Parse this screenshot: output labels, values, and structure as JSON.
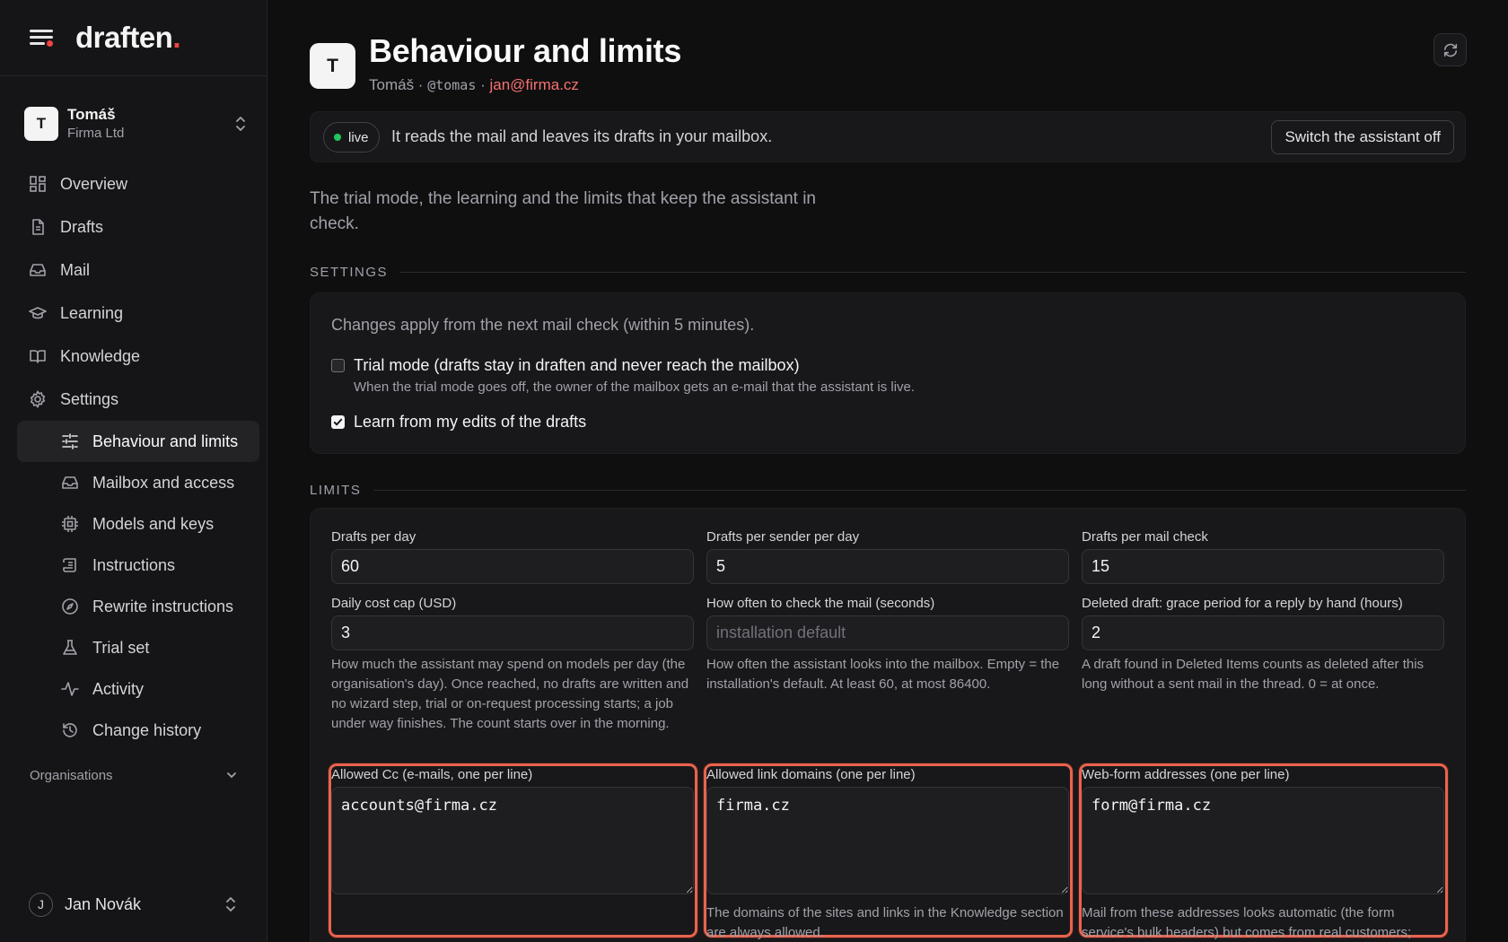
{
  "brand": {
    "name": "draften",
    "dot": "."
  },
  "account": {
    "initial": "T",
    "name": "Tomáš",
    "org": "Firma Ltd"
  },
  "nav": {
    "items": [
      {
        "label": "Overview"
      },
      {
        "label": "Drafts"
      },
      {
        "label": "Mail"
      },
      {
        "label": "Learning"
      },
      {
        "label": "Knowledge"
      },
      {
        "label": "Settings"
      }
    ],
    "settings_sub": [
      {
        "label": "Behaviour and limits"
      },
      {
        "label": "Mailbox and access"
      },
      {
        "label": "Models and keys"
      },
      {
        "label": "Instructions"
      },
      {
        "label": "Rewrite instructions"
      },
      {
        "label": "Trial set"
      },
      {
        "label": "Activity"
      },
      {
        "label": "Change history"
      }
    ],
    "organisations_label": "Organisations"
  },
  "user": {
    "initial": "J",
    "name": "Jan Novák"
  },
  "header": {
    "avatar_initial": "T",
    "title": "Behaviour and limits",
    "name": "Tomáš",
    "sep1": " · ",
    "handle": "@tomas",
    "sep2": " · ",
    "email": "jan@firma.cz"
  },
  "status": {
    "badge": "live",
    "text": "It reads the mail and leaves its drafts in your mailbox.",
    "button": "Switch the assistant off"
  },
  "intro": "The trial mode, the learning and the limits that keep the assistant in check.",
  "settings": {
    "section_label": "SETTINGS",
    "note": "Changes apply from the next mail check (within 5 minutes).",
    "trial_mode": {
      "label": "Trial mode (drafts stay in draften and never reach the mailbox)",
      "help": "When the trial mode goes off, the owner of the mailbox gets an e-mail that the assistant is live.",
      "checked": false
    },
    "learn_edits": {
      "label": "Learn from my edits of the drafts",
      "checked": true
    }
  },
  "limits": {
    "section_label": "LIMITS",
    "drafts_per_day": {
      "label": "Drafts per day",
      "value": "60"
    },
    "drafts_per_sender": {
      "label": "Drafts per sender per day",
      "value": "5"
    },
    "drafts_per_check": {
      "label": "Drafts per mail check",
      "value": "15"
    },
    "daily_cost_cap": {
      "label": "Daily cost cap (USD)",
      "value": "3",
      "help": "How much the assistant may spend on models per day (the organisation's day). Once reached, no drafts are written and no wizard step, trial or on-request processing starts; a job under way finishes. The count starts over in the morning."
    },
    "check_interval": {
      "label": "How often to check the mail (seconds)",
      "value": "",
      "placeholder": "installation default",
      "help": "How often the assistant looks into the mailbox. Empty = the installation's default. At least 60, at most 86400."
    },
    "grace_period": {
      "label": "Deleted draft: grace period for a reply by hand (hours)",
      "value": "2",
      "help": "A draft found in Deleted Items counts as deleted after this long without a sent mail in the thread. 0 = at once."
    },
    "allowed_cc": {
      "label": "Allowed Cc (e-mails, one per line)",
      "value": "accounts@firma.cz"
    },
    "allowed_domains": {
      "label": "Allowed link domains (one per line)",
      "value": "firma.cz",
      "help": "The domains of the sites and links in the Knowledge section are always allowed."
    },
    "webform_addresses": {
      "label": "Web-form addresses (one per line)",
      "value": "form@firma.cz",
      "help": "Mail from these addresses looks automatic (the form service's bulk headers) but comes from real customers;"
    }
  },
  "colors": {
    "accent": "#ef4444",
    "live": "#22c55e",
    "highlight": "#e8644f",
    "email": "#f87171"
  }
}
